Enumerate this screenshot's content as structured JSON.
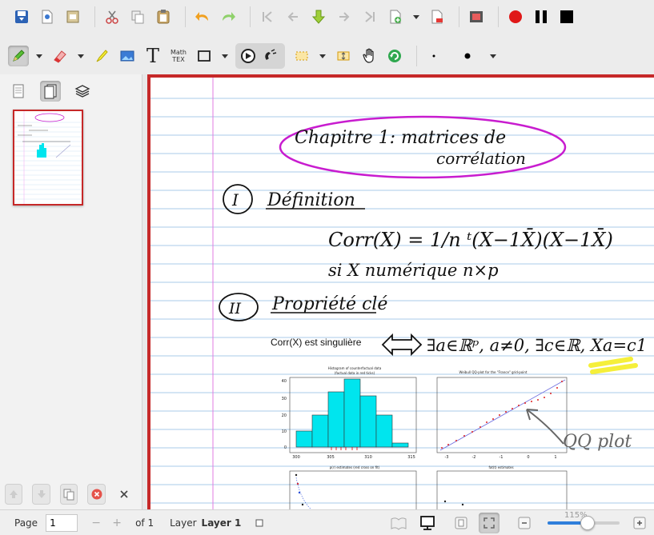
{
  "toolbar_main": {
    "buttons": [
      "save-icon",
      "new-page-icon",
      "document-icon",
      "cut-icon",
      "copy-icon",
      "paste-icon",
      "undo-icon",
      "redo-icon",
      "first-page-icon",
      "previous-page-icon",
      "insert-page-icon",
      "next-page-icon",
      "last-page-icon",
      "add-page-icon",
      "delete-page-icon",
      "film-icon",
      "record-icon",
      "pause-icon",
      "stop-icon"
    ]
  },
  "toolbar_tools": {
    "math_tex_label_line1": "Math",
    "math_tex_label_line2": "TEX",
    "text_tool_glyph": "T"
  },
  "left_panel": {
    "tabs": [
      "single-page-icon",
      "page-icon",
      "layers-icon"
    ],
    "thumbnail_selected": true
  },
  "page": {
    "printed_text": "Corr(X) est singulière",
    "handwriting": {
      "title_line1": "Chapitre 1: matrices de",
      "title_line2": "corrélation",
      "section1_number": "I",
      "section1_title": "Définition",
      "formula": "Corr(X) = 1/n ᵗ(X−1X̄)(X−1X̄)",
      "formula_condition": "si X numérique n×p",
      "section2_number": "II",
      "section2_title": "Propriété clé",
      "equivalence": "∃a∈ℝᵖ, a≠0, ∃c∈ℝ, Xa=c1",
      "annotation": "QQ plot"
    },
    "charts": {
      "histogram_title": "Histogram of counterfactual data",
      "histogram_subtitle": "(factual data in red ticks)",
      "histogram_yticks": [
        "0",
        "10",
        "20",
        "30",
        "40"
      ],
      "histogram_xticks": [
        "300",
        "305",
        "310",
        "315"
      ],
      "qq_title": "Weibull QQ-plot for the \"France\" grid-point",
      "qq_xticks": [
        "-3",
        "-2",
        "-1",
        "0",
        "1"
      ],
      "rho_title": "p(r) estimates (red cross on fit)",
      "fat_title": "fat(t) estimates"
    }
  },
  "status_bar": {
    "page_label": "Page",
    "page_value": "1",
    "minus": "−",
    "plus": "+",
    "of_label": "of 1",
    "layer_label": "Layer",
    "layer_value": "Layer 1",
    "zoom_value": "115%",
    "zoom_fraction": 0.55
  },
  "colors": {
    "accent": "#c62828",
    "ink": "#111111",
    "title_oval": "#c81ccf",
    "highlight": "#f5ef3a",
    "histogram_bars": "#00e5ee",
    "ruled_lines": "#a8cbe8",
    "margin_line": "#e07be0"
  }
}
